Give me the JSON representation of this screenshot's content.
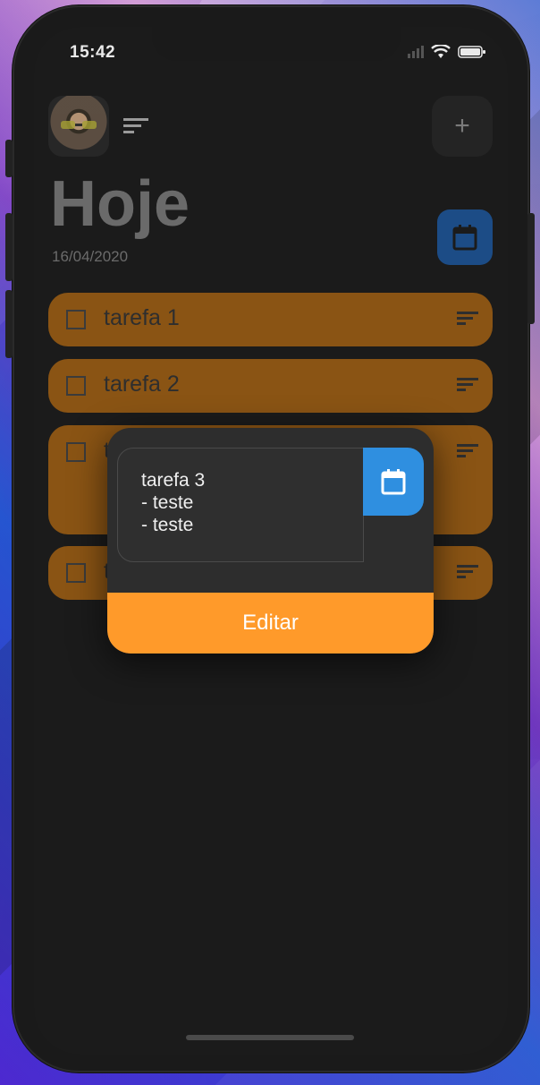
{
  "status": {
    "time": "15:42",
    "icons": [
      "signal-icon",
      "wifi-icon",
      "battery-icon"
    ]
  },
  "header": {
    "add_label": "+",
    "title": "Hoje",
    "date": "16/04/2020"
  },
  "tasks": [
    {
      "label": "tarefa 1"
    },
    {
      "label": "tarefa 2"
    },
    {
      "label": "t"
    },
    {
      "label": "t"
    }
  ],
  "overlay": {
    "note_lines": [
      "tarefa 3",
      "- teste",
      "- teste"
    ],
    "edit_label": "Editar"
  },
  "colors": {
    "task_bg": "#8a5414",
    "accent_blue": "#2f8fe0",
    "edit_orange": "#ff9a2a"
  }
}
